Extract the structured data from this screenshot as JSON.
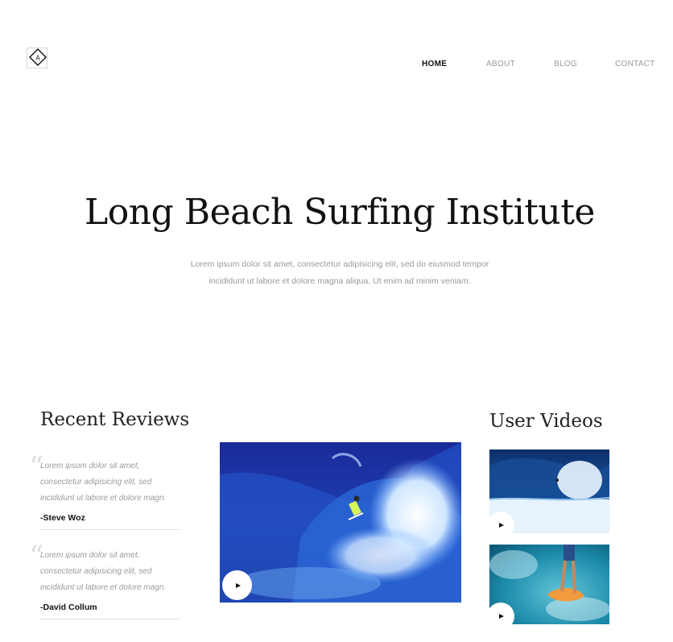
{
  "logo": {
    "letter": "A",
    "icon": "diamond-logo-icon"
  },
  "nav": {
    "items": [
      {
        "label": "HOME",
        "active": true
      },
      {
        "label": "ABOUT",
        "active": false
      },
      {
        "label": "BLOG",
        "active": false
      },
      {
        "label": "CONTACT",
        "active": false
      }
    ]
  },
  "hero": {
    "title": "Long Beach Surfing Institute",
    "subtitle": "Lorem ipsum dolor sit amet, consectetur adipisicing elit, sed do eiusmod tempor incididunt ut labore et dolore magna aliqua. Ut enim ad minim veniam."
  },
  "reviews": {
    "title": "Recent Reviews",
    "items": [
      {
        "text": "Lorem ipsum dolor sit amet, consectetur adipisicing elit, sed incididunt ut labore et dolore magn.",
        "author": "-Steve Woz"
      },
      {
        "text": "Lorem ipsum dolor sit amet, consectetur adipisicing elit, sed incididunt ut labore et dolore magn.",
        "author": "-David Collum"
      }
    ]
  },
  "videos": {
    "title": "User Videos",
    "play_icon": "play-icon"
  },
  "colors": {
    "text_dark": "#111111",
    "text_muted": "#9a9a9a",
    "wave_deep": "#1c2a8c",
    "wave_light": "#5fa3e0"
  }
}
